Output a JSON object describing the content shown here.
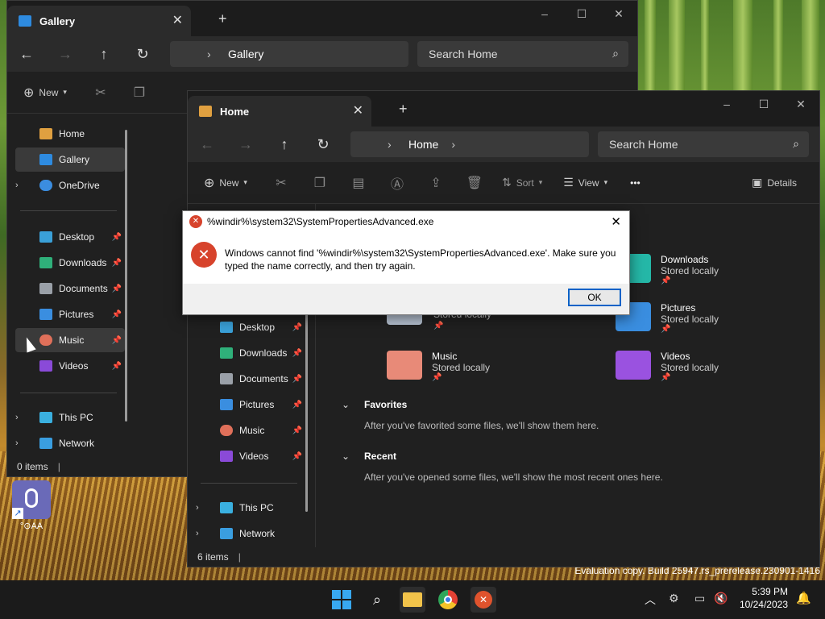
{
  "desktop": {
    "shortcut_label": "°⊙AA",
    "watermark": "Evaluation copy. Build 25947.rs_prerelease.230901-1416"
  },
  "gallery_window": {
    "tab_title": "Gallery",
    "address": "Gallery",
    "search_placeholder": "Search Home",
    "toolbar_new": "New",
    "sidebar": {
      "home": "Home",
      "gallery": "Gallery",
      "onedrive": "OneDrive",
      "desktop": "Desktop",
      "downloads": "Downloads",
      "documents": "Documents",
      "pictures": "Pictures",
      "music": "Music",
      "videos": "Videos",
      "this_pc": "This PC",
      "network": "Network"
    },
    "status": "0 items"
  },
  "home_window": {
    "tab_title": "Home",
    "address": "Home",
    "search_placeholder": "Search Home",
    "toolbar": {
      "new": "New",
      "sort": "Sort",
      "view": "View",
      "more": "•••",
      "details": "Details"
    },
    "sidebar": {
      "desktop": "Desktop",
      "downloads": "Downloads",
      "documents": "Documents",
      "pictures": "Pictures",
      "music": "Music",
      "videos": "Videos",
      "this_pc": "This PC",
      "network": "Network"
    },
    "quick_access": [
      {
        "name": "Downloads",
        "sub": "Stored locally"
      },
      {
        "name": "Pictures",
        "sub": "Stored locally"
      },
      {
        "name": "Music",
        "sub": "Stored locally"
      },
      {
        "name": "Videos",
        "sub": "Stored locally"
      }
    ],
    "documents_sub": "Stored locally",
    "favorites": {
      "title": "Favorites",
      "text": "After you've favorited some files, we'll show them here."
    },
    "recent": {
      "title": "Recent",
      "text": "After you've opened some files, we'll show the most recent ones here."
    },
    "status": "6 items"
  },
  "dialog": {
    "title": "%windir%\\system32\\SystemPropertiesAdvanced.exe",
    "message_line1": "Windows cannot find '%windir%\\system32\\SystemPropertiesAdvanced.exe'. Make sure you",
    "message_line2": "typed the name correctly, and then try again.",
    "ok": "OK"
  },
  "tray": {
    "time": "5:39 PM",
    "date": "10/24/2023"
  }
}
